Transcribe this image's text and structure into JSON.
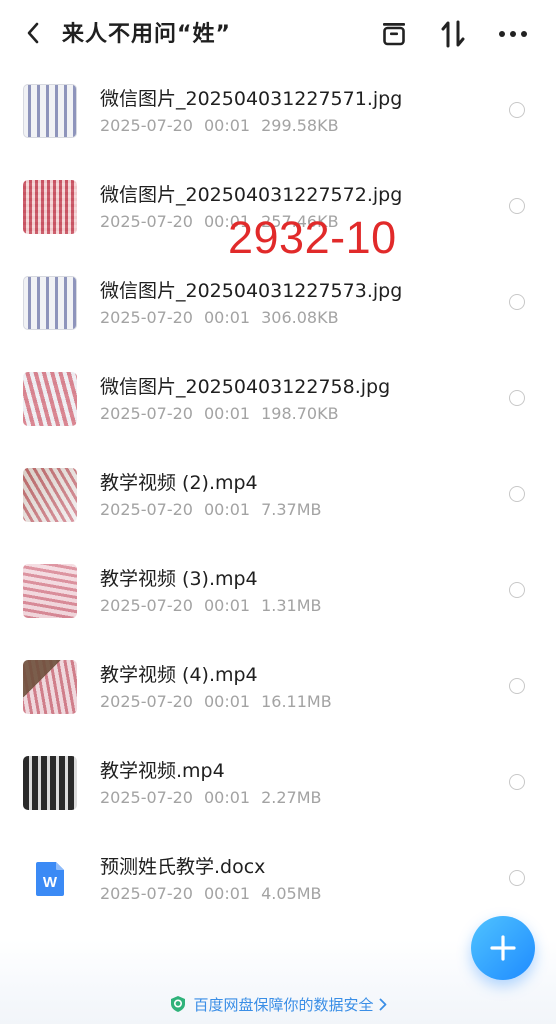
{
  "header": {
    "title": "来人不用问“姓”",
    "back_icon": "chevron-left-icon",
    "archive_icon": "archive-icon",
    "sort_icon": "sort-icon",
    "more_icon": "more-icon"
  },
  "files": [
    {
      "name": "微信图片_202504031227571.jpg",
      "date": "2025-07-20",
      "time": "00:01",
      "size": "299.58KB",
      "thumb": "white-grid"
    },
    {
      "name": "微信图片_202504031227572.jpg",
      "date": "2025-07-20",
      "time": "00:01",
      "size": "257.46KB",
      "thumb": "red-grid"
    },
    {
      "name": "微信图片_202504031227573.jpg",
      "date": "2025-07-20",
      "time": "00:01",
      "size": "306.08KB",
      "thumb": "white-grid"
    },
    {
      "name": "微信图片_20250403122758.jpg",
      "date": "2025-07-20",
      "time": "00:01",
      "size": "198.70KB",
      "thumb": "red-sheets"
    },
    {
      "name": "教学视频 (2).mp4",
      "date": "2025-07-20",
      "time": "00:01",
      "size": "7.37MB",
      "thumb": "hand"
    },
    {
      "name": "教学视频 (3).mp4",
      "date": "2025-07-20",
      "time": "00:01",
      "size": "1.31MB",
      "thumb": "pink"
    },
    {
      "name": "教学视频 (4).mp4",
      "date": "2025-07-20",
      "time": "00:01",
      "size": "16.11MB",
      "thumb": "brown"
    },
    {
      "name": "教学视频.mp4",
      "date": "2025-07-20",
      "time": "00:01",
      "size": "2.27MB",
      "thumb": "dark"
    },
    {
      "name": "预测姓氏教学.docx",
      "date": "2025-07-20",
      "time": "00:01",
      "size": "4.05MB",
      "thumb": "word-doc-icon"
    }
  ],
  "watermark": "2932-10",
  "fab": {
    "icon": "plus-icon"
  },
  "footer": {
    "text": "百度网盘保障你的数据安全",
    "icon": "shield-icon",
    "chevron": "chevron-right-icon"
  },
  "colors": {
    "accent": "#1f8bff",
    "watermark": "#e12a2a",
    "meta_text": "#a3a3a3",
    "footer_text": "#3a8ee6"
  }
}
